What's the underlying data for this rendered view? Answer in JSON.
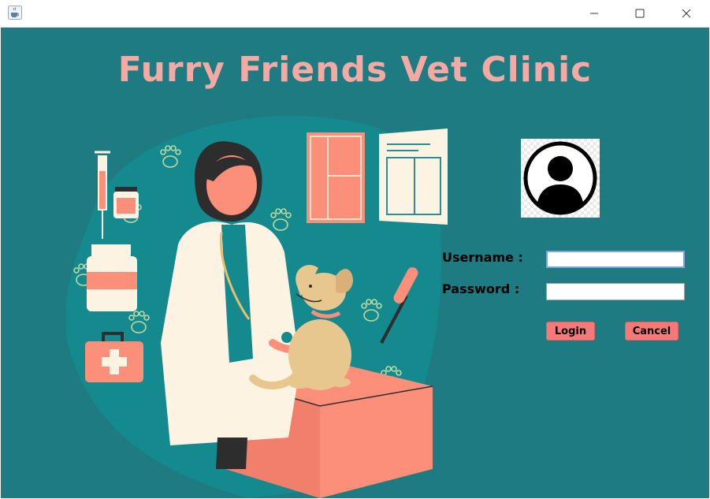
{
  "window": {
    "app_icon": "java-cup-icon",
    "controls": [
      "minimize-icon",
      "maximize-icon",
      "close-icon"
    ]
  },
  "header": {
    "title": "Furry Friends Vet Clinic"
  },
  "login": {
    "avatar_icon": "user-avatar-icon",
    "username_label": "Username :",
    "password_label": "Password :",
    "username_value": "",
    "password_value": "",
    "login_label": "Login",
    "cancel_label": "Cancel"
  },
  "colors": {
    "background": "#1e7b82",
    "title": "#f4a9a3",
    "button": "#f47a7a"
  }
}
